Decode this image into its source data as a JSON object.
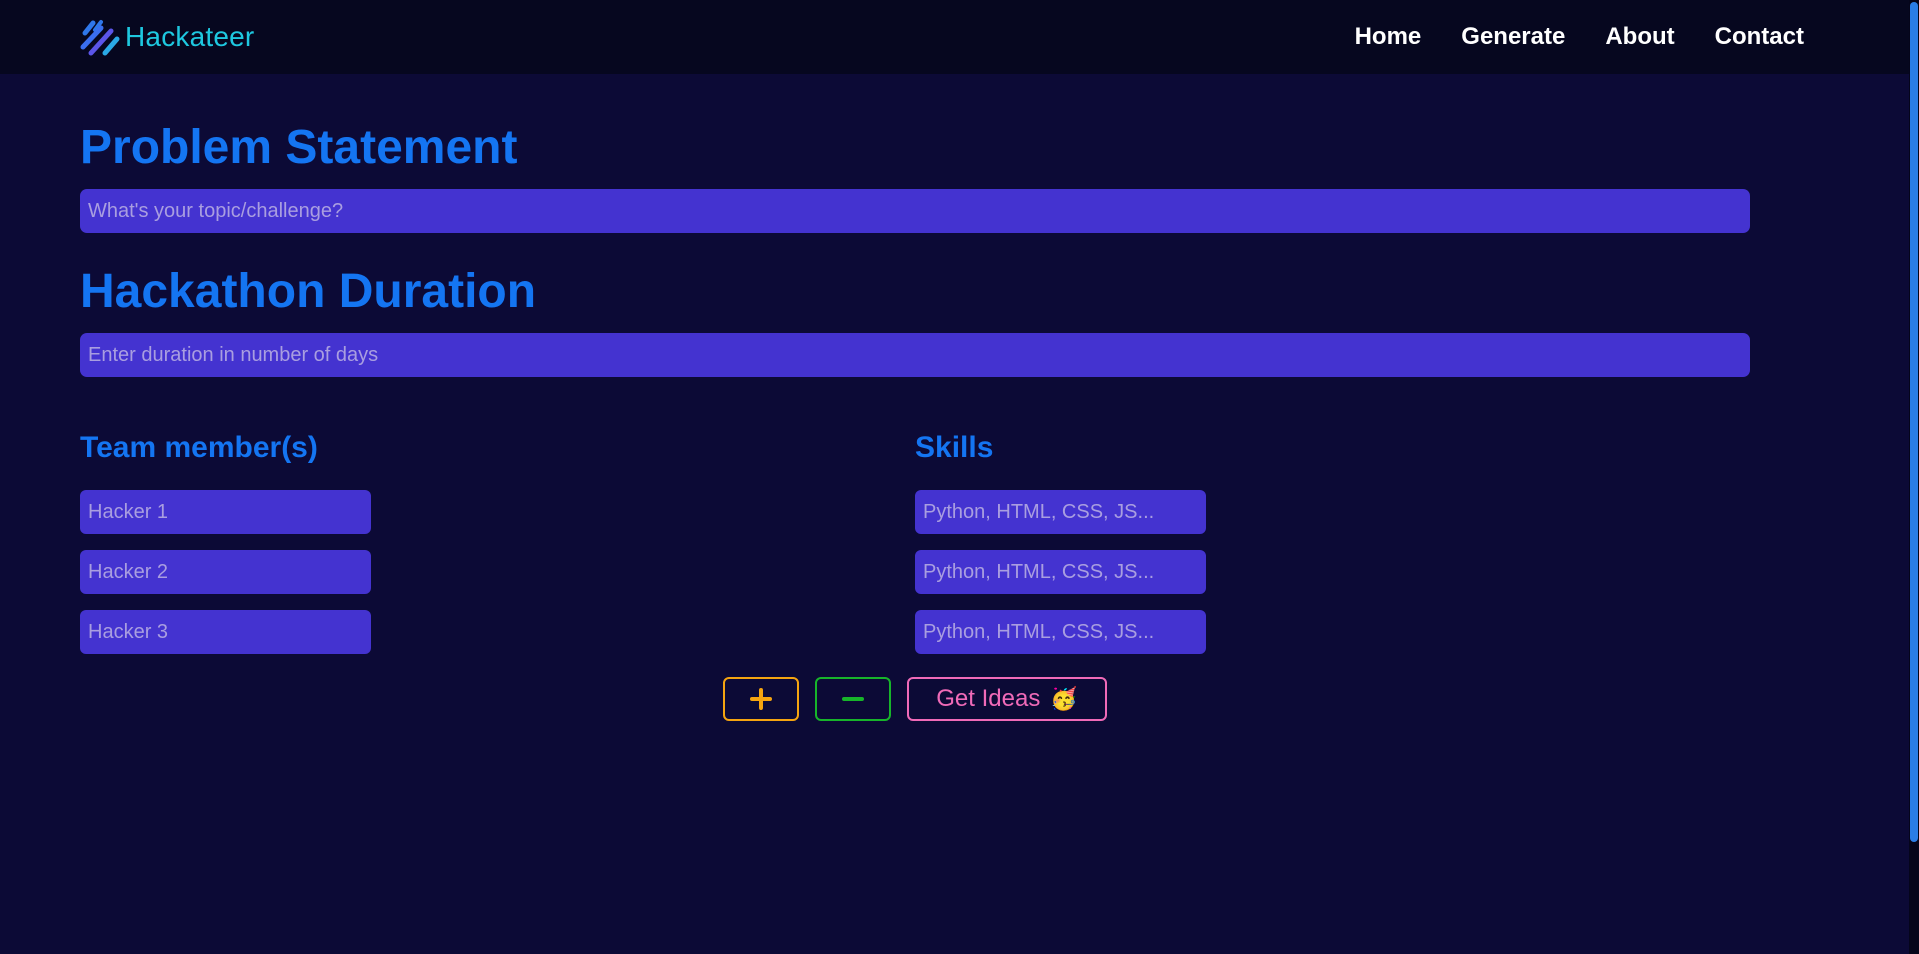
{
  "brand": {
    "name": "Hackateer",
    "color": "#1ec8e0"
  },
  "nav": {
    "items": [
      {
        "label": "Home"
      },
      {
        "label": "Generate"
      },
      {
        "label": "About"
      },
      {
        "label": "Contact"
      }
    ]
  },
  "problem": {
    "title": "Problem Statement",
    "placeholder": "What's your topic/challenge?",
    "value": ""
  },
  "duration": {
    "title": "Hackathon Duration",
    "placeholder": "Enter duration in number of days",
    "value": ""
  },
  "team": {
    "title": "Team member(s)",
    "members": [
      {
        "placeholder": "Hacker 1",
        "value": ""
      },
      {
        "placeholder": "Hacker 2",
        "value": ""
      },
      {
        "placeholder": "Hacker 3",
        "value": ""
      }
    ]
  },
  "skills": {
    "title": "Skills",
    "entries": [
      {
        "placeholder": "Python, HTML, CSS, JS...",
        "value": ""
      },
      {
        "placeholder": "Python, HTML, CSS, JS...",
        "value": ""
      },
      {
        "placeholder": "Python, HTML, CSS, JS...",
        "value": ""
      }
    ]
  },
  "actions": {
    "add_icon": "plus-icon",
    "remove_icon": "minus-icon",
    "get_ideas_label": "Get Ideas",
    "get_ideas_emoji": "🥳"
  },
  "colors": {
    "background": "#0c0a36",
    "navbar": "#06071f",
    "heading": "#1475f2",
    "input_bg": "#4433d0",
    "add_accent": "#f5a410",
    "remove_accent": "#17b52a",
    "ideas_accent": "#f06ab8"
  }
}
